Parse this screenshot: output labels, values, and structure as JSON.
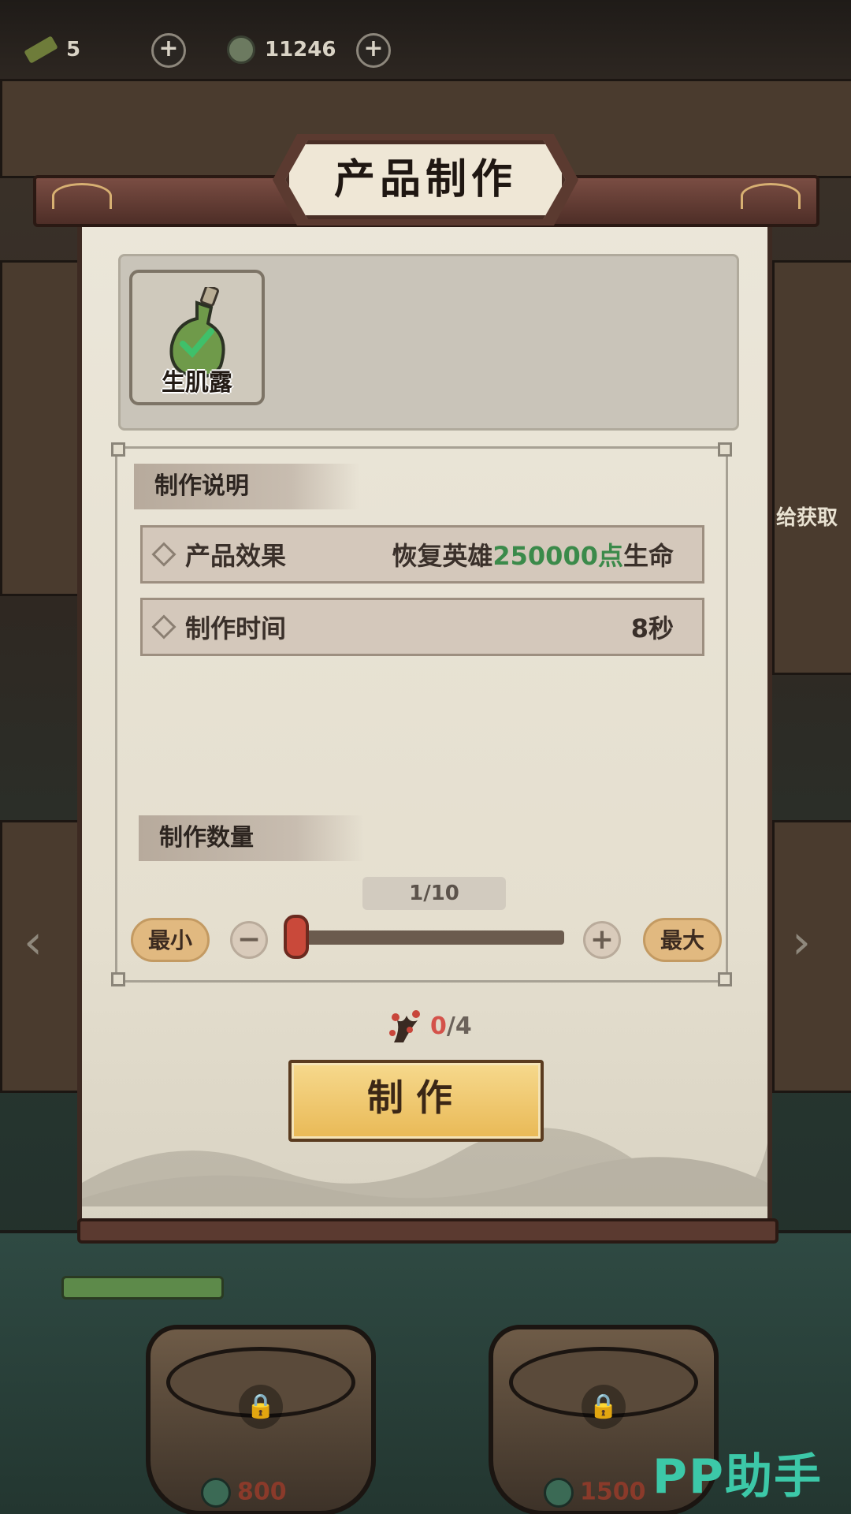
{
  "top_bar": {
    "jade_count": "5",
    "coin_count": "11246"
  },
  "panel": {
    "title": "产品制作",
    "item": {
      "name": "生肌露",
      "icon": "green-potion-bottle-icon"
    },
    "description_section": {
      "title": "制作说明",
      "effect_label": "产品效果",
      "effect_prefix": "恢复英雄",
      "effect_amount": "250000点",
      "effect_suffix": "生命",
      "time_label": "制作时间",
      "time_value": "8秒"
    },
    "quantity_section": {
      "title": "制作数量",
      "count_display": "1/10",
      "current": 1,
      "max": 10,
      "min_label": "最小",
      "max_label": "最大",
      "minus": "−",
      "plus": "+"
    },
    "material": {
      "have": "0",
      "need": "/4",
      "icon": "branch-material-icon"
    },
    "make_button": "制作"
  },
  "background": {
    "side_text": "给获取",
    "tub_prices": [
      "800",
      "1500"
    ]
  },
  "watermark": "PP助手",
  "colors": {
    "accent_green": "#3b8a4a",
    "material_red": "#d4524a",
    "button_gold": "#e9b956"
  }
}
